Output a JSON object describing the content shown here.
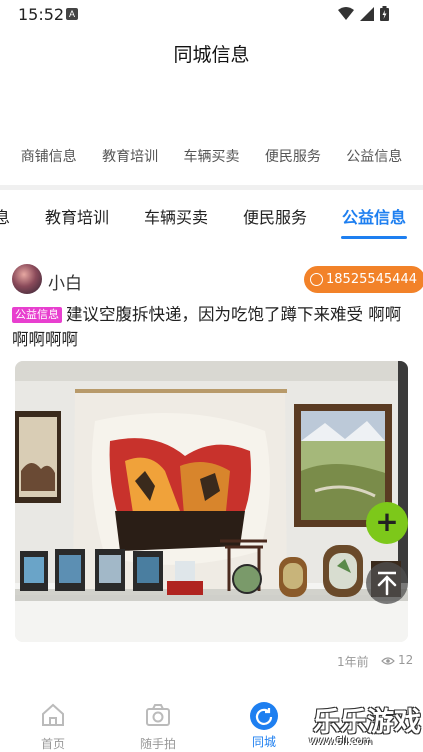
{
  "status_bar": {
    "time": "15:52",
    "notification_letter": "A"
  },
  "header": {
    "title": "同城信息"
  },
  "top_tabs": [
    "商铺信息",
    "教育培训",
    "车辆买卖",
    "便民服务",
    "公益信息"
  ],
  "category_tabs": {
    "items": [
      "息",
      "教育培训",
      "车辆买卖",
      "便民服务",
      "公益信息"
    ],
    "active_index": 4
  },
  "post": {
    "user_name": "小白",
    "phone": "18525545444",
    "tag": "公益信息",
    "text": "建议空腹拆快递，因为吃饱了蹲下来难受 啊啊啊啊啊啊",
    "time": "1年前",
    "views": "12"
  },
  "fab": {
    "add_symbol": "+"
  },
  "bottom_nav": [
    {
      "label": "首页",
      "icon": "home-icon",
      "active": false
    },
    {
      "label": "随手拍",
      "icon": "camera-icon",
      "active": false
    },
    {
      "label": "同城",
      "icon": "refresh-icon",
      "active": true
    }
  ],
  "watermark": {
    "text": "乐乐游戏",
    "url": "www.6ll.com"
  },
  "colors": {
    "accent": "#1e7ff0",
    "phone_badge": "#f28229",
    "tag": "#e83fcf",
    "fab_add": "#7dc81a"
  }
}
